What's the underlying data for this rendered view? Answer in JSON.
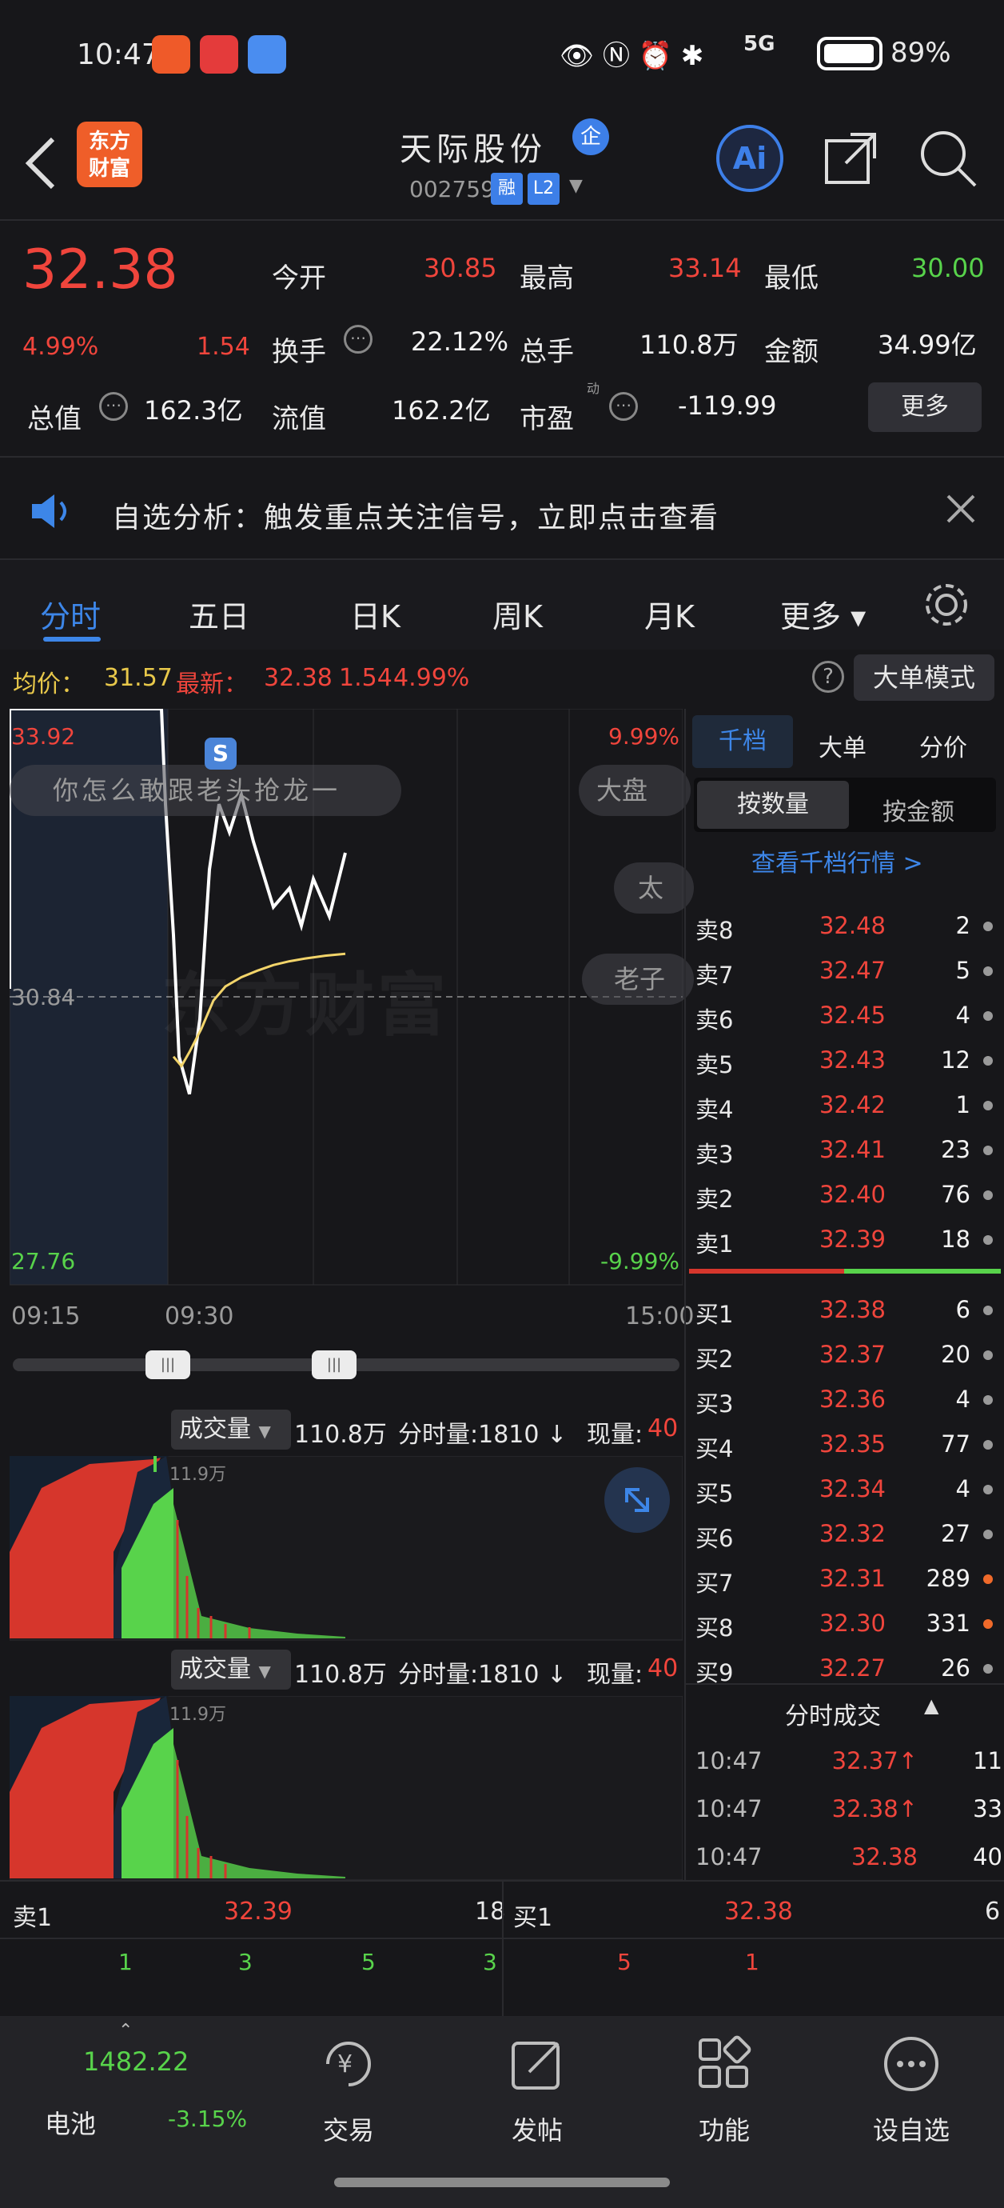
{
  "status_bar": {
    "time": "10:47",
    "battery": "89%",
    "network": "5G"
  },
  "header": {
    "title": "天际股份",
    "badge": "企",
    "code": "002759",
    "tag_rong": "融",
    "tag_level": "L2",
    "logo_line1": "东方",
    "logo_line2": "财富",
    "ai_label": "Ai"
  },
  "quote": {
    "price": "32.38",
    "change_pct": "4.99%",
    "change": "1.54",
    "open_label": "今开",
    "open": "30.85",
    "high_label": "最高",
    "high": "33.14",
    "low_label": "最低",
    "low": "30.00",
    "turnover_label": "换手",
    "turnover": "22.12%",
    "volume_label": "总手",
    "volume": "110.8万",
    "amount_label": "金额",
    "amount": "34.99亿",
    "mcap_label": "总值",
    "mcap": "162.3亿",
    "float_label": "流值",
    "float": "162.2亿",
    "pe_label": "市盈",
    "pe_sub": "动",
    "pe": "-119.99",
    "more_label": "更多"
  },
  "notice": {
    "text": "自选分析：触发重点关注信号，立即点击查看"
  },
  "tabs": [
    {
      "label": "分时"
    },
    {
      "label": "五日"
    },
    {
      "label": "日K"
    },
    {
      "label": "周K"
    },
    {
      "label": "月K"
    },
    {
      "label": "更多 ▾"
    }
  ],
  "stats": {
    "avg_label": "均价：",
    "avg": "31.57",
    "latest_label": "最新：",
    "latest": "32.38",
    "latest_change": "1.54",
    "latest_pct": "4.99%",
    "mode_label": "大单模式"
  },
  "chart": {
    "price_top": "33.92",
    "price_mid": "30.84",
    "price_bottom": "27.76",
    "pct_top": "9.99%",
    "pct_bottom": "-9.99%",
    "time_start": "09:15",
    "time_mid": "09:30",
    "time_end": "15:00",
    "comment_bubble": "你怎么敢跟老头抢龙一",
    "chip_dapan": "大盘",
    "chip_tai": "太",
    "chip_laozi": "老子",
    "s_marker": "S",
    "watermark": "东方财富",
    "vol1_dropdown": "成交量",
    "vol_total": "110.8万",
    "vol_minute": "分时量:1810 ↓",
    "vol_now_label": "现量:",
    "vol_now": "40",
    "vol_scale": "11.9万",
    "vol2_dropdown": "成交量"
  },
  "chart_data": {
    "type": "line",
    "title": "",
    "x_range": [
      "09:15",
      "15:00"
    ],
    "ylim": [
      27.76,
      33.92
    ],
    "reference": 30.84,
    "series": [
      {
        "values": [
          33.92,
          33.92,
          33.92,
          32.9,
          31.5,
          30.2,
          29.8,
          30.6,
          32.2,
          32.9,
          32.6,
          33.0,
          32.5,
          31.8,
          32.0,
          31.6,
          32.1,
          31.7,
          32.38
        ]
      },
      {
        "values": [
          30.2,
          30.1,
          30.25,
          30.5,
          30.8,
          30.95,
          31.05,
          31.12,
          31.18,
          31.22,
          31.25,
          31.28,
          31.3
        ]
      }
    ]
  },
  "orderbook": {
    "tabs": [
      "千档",
      "大单",
      "分价"
    ],
    "mode_tabs": [
      "按数量",
      "按金额"
    ],
    "view_link": "查看千档行情 >",
    "asks": [
      {
        "label": "卖8",
        "price": "32.48",
        "vol": "2",
        "hl": false
      },
      {
        "label": "卖7",
        "price": "32.47",
        "vol": "5",
        "hl": false
      },
      {
        "label": "卖6",
        "price": "32.45",
        "vol": "4",
        "hl": false
      },
      {
        "label": "卖5",
        "price": "32.43",
        "vol": "12",
        "hl": false
      },
      {
        "label": "卖4",
        "price": "32.42",
        "vol": "1",
        "hl": false
      },
      {
        "label": "卖3",
        "price": "32.41",
        "vol": "23",
        "hl": false
      },
      {
        "label": "卖2",
        "price": "32.40",
        "vol": "76",
        "hl": false
      },
      {
        "label": "卖1",
        "price": "32.39",
        "vol": "18",
        "hl": false
      }
    ],
    "bids": [
      {
        "label": "买1",
        "price": "32.38",
        "vol": "6",
        "hl": false
      },
      {
        "label": "买2",
        "price": "32.37",
        "vol": "20",
        "hl": false
      },
      {
        "label": "买3",
        "price": "32.36",
        "vol": "4",
        "hl": false
      },
      {
        "label": "买4",
        "price": "32.35",
        "vol": "77",
        "hl": false
      },
      {
        "label": "买5",
        "price": "32.34",
        "vol": "4",
        "hl": false
      },
      {
        "label": "买6",
        "price": "32.32",
        "vol": "27",
        "hl": false
      },
      {
        "label": "买7",
        "price": "32.31",
        "vol": "289",
        "hl": true
      },
      {
        "label": "买8",
        "price": "32.30",
        "vol": "331",
        "hl": true
      },
      {
        "label": "买9",
        "price": "32.27",
        "vol": "26",
        "hl": false
      }
    ],
    "trades_header": "分时成交",
    "trades": [
      {
        "time": "10:47",
        "price": "32.37↑",
        "vol": "11"
      },
      {
        "time": "10:47",
        "price": "32.38↑",
        "vol": "33"
      },
      {
        "time": "10:47",
        "price": "32.38",
        "vol": "40"
      }
    ]
  },
  "bottom_quote": {
    "sell_label": "卖1",
    "sell_price": "32.39",
    "sell_vol": "18",
    "buy_label": "买1",
    "buy_price": "32.38",
    "buy_vol": "6",
    "row2_left": [
      "1",
      "3",
      "5",
      "3"
    ],
    "row2_right": [
      "5",
      "1"
    ]
  },
  "nav": {
    "index_value": "1482.22",
    "index_name": "电池",
    "index_pct": "-3.15%",
    "items": [
      {
        "label": "交易"
      },
      {
        "label": "发帖"
      },
      {
        "label": "功能"
      },
      {
        "label": "设自选"
      }
    ]
  }
}
